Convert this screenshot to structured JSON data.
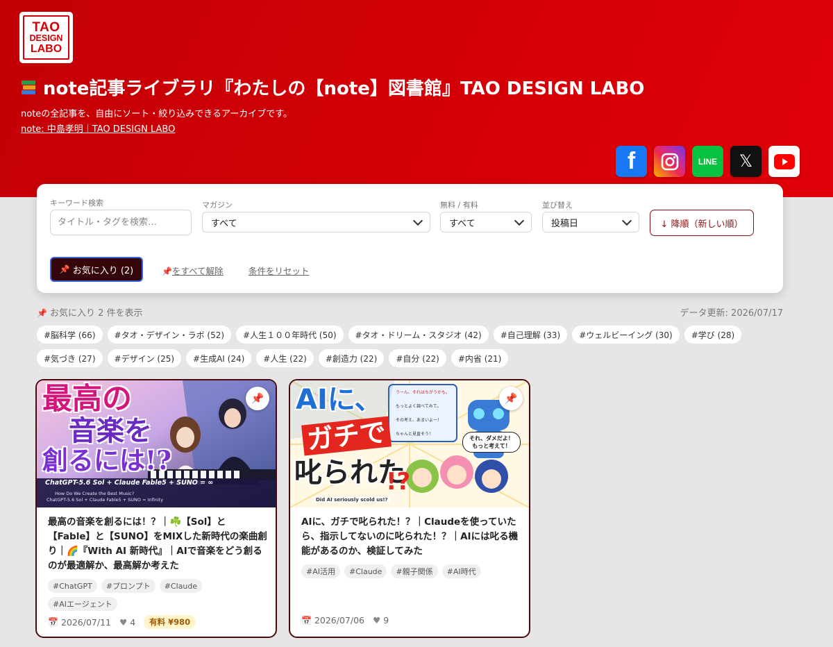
{
  "header": {
    "logo": {
      "line1": "TAO",
      "line2": "DESIGN",
      "line3": "LABO"
    },
    "title": "note記事ライブラリ『わたしの【note】図書館』TAO DESIGN LABO",
    "title_icon": "books-icon",
    "subtitle": "noteの全記事を、自由にソート・絞り込みできるアーカイブです。",
    "note_link": "note: 中島孝明｜TAO DESIGN LABO",
    "social": [
      {
        "name": "facebook",
        "glyph": "f"
      },
      {
        "name": "instagram",
        "glyph": ""
      },
      {
        "name": "line",
        "glyph": "LINE"
      },
      {
        "name": "x",
        "glyph": "𝕏"
      },
      {
        "name": "youtube",
        "glyph": ""
      }
    ],
    "colors": {
      "brand_red": "#d40006"
    }
  },
  "filters": {
    "keyword": {
      "label": "キーワード検索",
      "placeholder": "タイトル・タグを検索…",
      "value": ""
    },
    "magazine": {
      "label": "マガジン",
      "value": "すべて"
    },
    "price": {
      "label": "無料 / 有料",
      "value": "すべて"
    },
    "sort": {
      "label": "並び替え",
      "value": "投稿日"
    },
    "order_button": "↓ 降順（新しい順）",
    "favorites_button": "お気に入り (2)",
    "unpin_all": "をすべて解除",
    "reset": "条件をリセット"
  },
  "results": {
    "summary": "お気に入り 2 件を表示",
    "updated": "データ更新: 2026/07/17"
  },
  "tags": [
    "#脳科学 (66)",
    "#タオ・デザイン・ラボ (52)",
    "#人生１００年時代 (50)",
    "#タオ・ドリーム・スタジオ (42)",
    "#自己理解 (33)",
    "#ウェルビーイング (30)",
    "#学び (28)",
    "#気づき (27)",
    "#デザイン (25)",
    "#生成AI (24)",
    "#人生 (22)",
    "#創造力 (22)",
    "#自分 (22)",
    "#内省 (21)"
  ],
  "articles": [
    {
      "thumb": {
        "line1": "最高の",
        "line2": "音楽を",
        "line3": "創るには!?",
        "banner": "ChatGPT-5.6 Sol + Claude Fable5 + SUNO = ∞",
        "banner_sub": "How Do We Create the Best Music?",
        "banner_sub2": "ChatGPT-5.6 Sol + Claude Fable5 + SUNO = Infinity"
      },
      "title": "最高の音楽を創るには！？｜☘️【Sol】と【Fable】と【SUNO】をMIXした新時代の楽曲創り｜🌈『With AI 新時代』｜AIで音楽をどう創るのが最適解か、最高解か考えた",
      "tags": [
        "#ChatGPT",
        "#プロンプト",
        "#Claude",
        "#AIエージェント"
      ],
      "date": "2026/07/11",
      "likes": "4",
      "price": "有料 ¥980"
    },
    {
      "thumb": {
        "line1": "AIに、",
        "line2": "ガチで",
        "line3": "叱られた",
        "mark": "!?",
        "bubble1": "うーん、それはちがうかも。",
        "bubble2": "もっとよく調べてみて。",
        "bubble3": "その考え、あまいよー！",
        "bubble4": "ちゃんと見直そう！",
        "callout": "それ、ダメだよ！もっと考えて！",
        "subtitle": "Did AI seriously scold us!?"
      },
      "title": "AIに、ガチで叱られた！？｜Claudeを使っていたら、指示してないのに叱られた！？｜AIには叱る機能があるのか、検証してみた",
      "tags": [
        "#AI活用",
        "#Claude",
        "#親子関係",
        "#AI時代"
      ],
      "date": "2026/07/06",
      "likes": "9",
      "price": ""
    }
  ]
}
